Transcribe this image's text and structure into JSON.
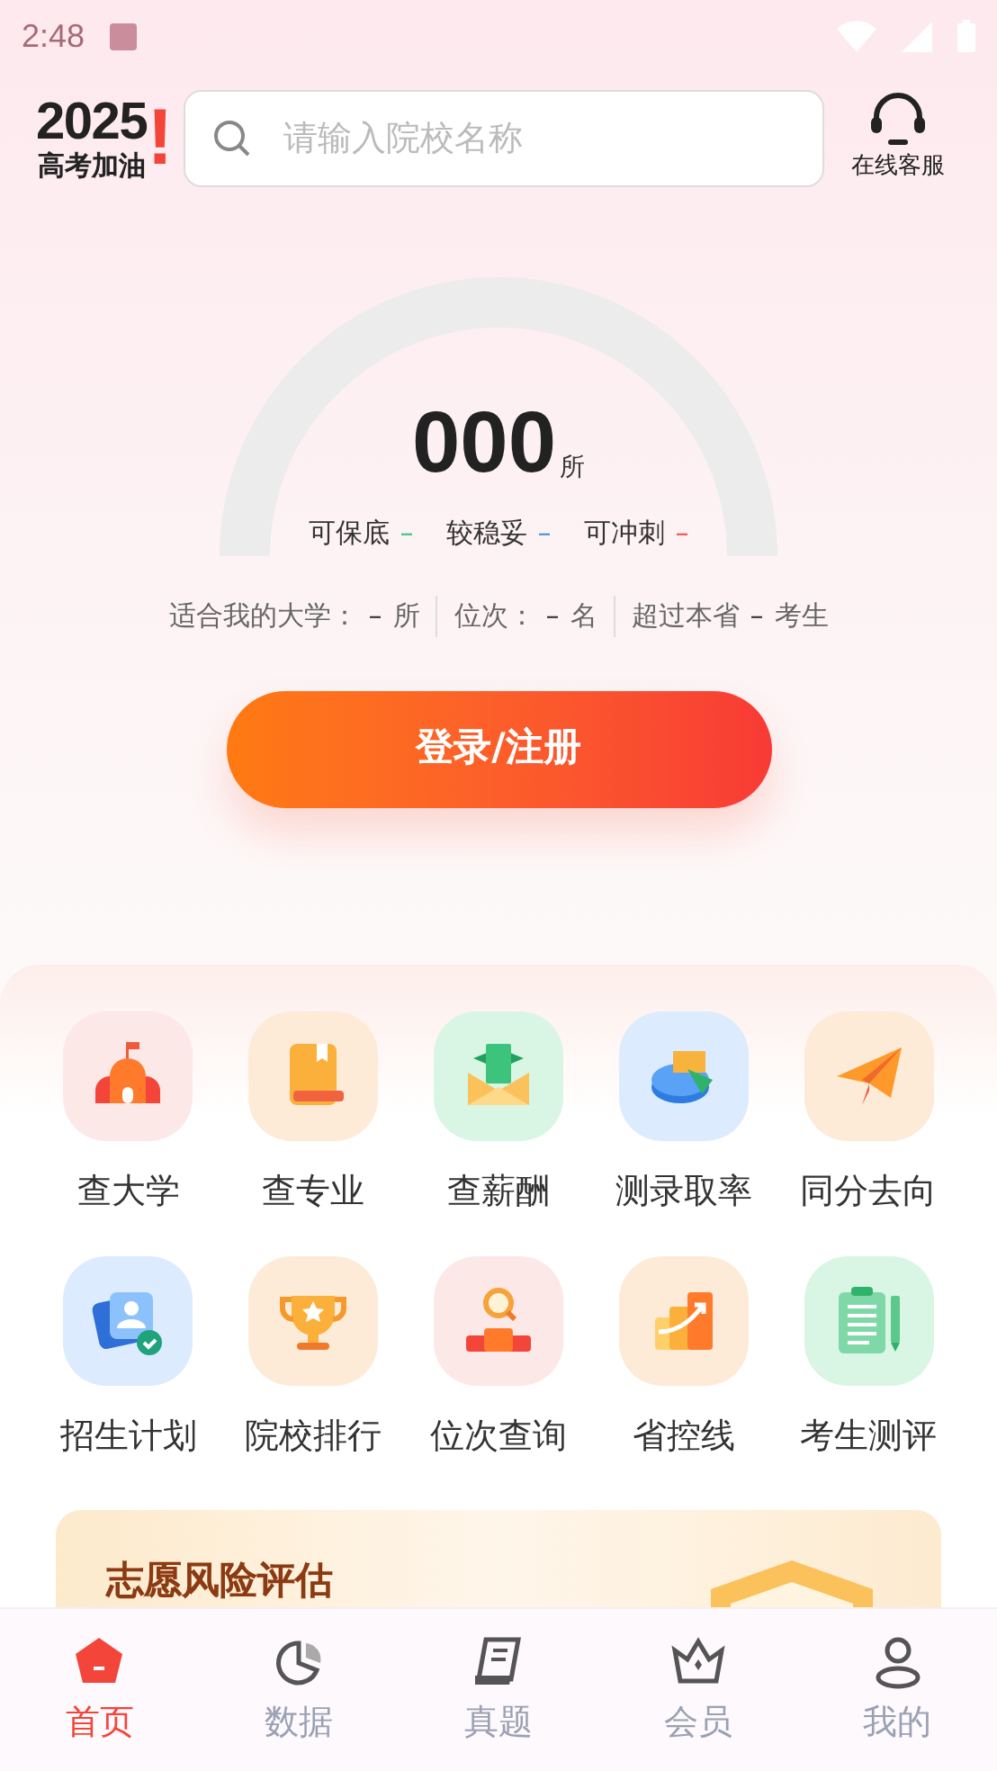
{
  "status_bar": {
    "time": "2:48"
  },
  "header": {
    "logo_year": "2025",
    "logo_mark": "!",
    "logo_slogan": "高考加油",
    "search": {
      "placeholder": "请输入院校名称"
    },
    "service": {
      "label": "在线客服"
    }
  },
  "gauge": {
    "count": "000",
    "unit": "所",
    "legend": [
      {
        "label": "可保底",
        "value": "–",
        "color": "#3cc47c"
      },
      {
        "label": "较稳妥",
        "value": "–",
        "color": "#4a90e2"
      },
      {
        "label": "可冲刺",
        "value": "–",
        "color": "#f0524c"
      }
    ]
  },
  "stats": [
    {
      "label": "适合我的大学：",
      "value": "–",
      "unit": "所"
    },
    {
      "label": "位次：",
      "value": "–",
      "unit": "名"
    },
    {
      "label": "超过本省",
      "value": "–",
      "unit": "考生"
    }
  ],
  "login_button": {
    "label": "登录/注册"
  },
  "features": [
    {
      "label": "查大学",
      "kind": "school",
      "color": "#fde8e8"
    },
    {
      "label": "查专业",
      "kind": "book",
      "color": "#fdebd8"
    },
    {
      "label": "查薪酬",
      "kind": "money",
      "color": "#d9f5e4"
    },
    {
      "label": "测录取率",
      "kind": "pie",
      "color": "#dcebfd"
    },
    {
      "label": "同分去向",
      "kind": "plane",
      "color": "#fdebd8"
    },
    {
      "label": "招生计划",
      "kind": "card",
      "color": "#dcebfd"
    },
    {
      "label": "院校排行",
      "kind": "trophy",
      "color": "#fdebd8"
    },
    {
      "label": "位次查询",
      "kind": "search",
      "color": "#fde8e8"
    },
    {
      "label": "省控线",
      "kind": "bars",
      "color": "#fdebd8"
    },
    {
      "label": "考生测评",
      "kind": "clipboard",
      "color": "#d9f5e4"
    }
  ],
  "banner": {
    "title": "志愿风险评估"
  },
  "nav": [
    {
      "label": "首页",
      "kind": "home",
      "selected": true
    },
    {
      "label": "数据",
      "kind": "data",
      "selected": false
    },
    {
      "label": "真题",
      "kind": "paper",
      "selected": false
    },
    {
      "label": "会员",
      "kind": "crown",
      "selected": false
    },
    {
      "label": "我的",
      "kind": "user",
      "selected": false
    }
  ]
}
